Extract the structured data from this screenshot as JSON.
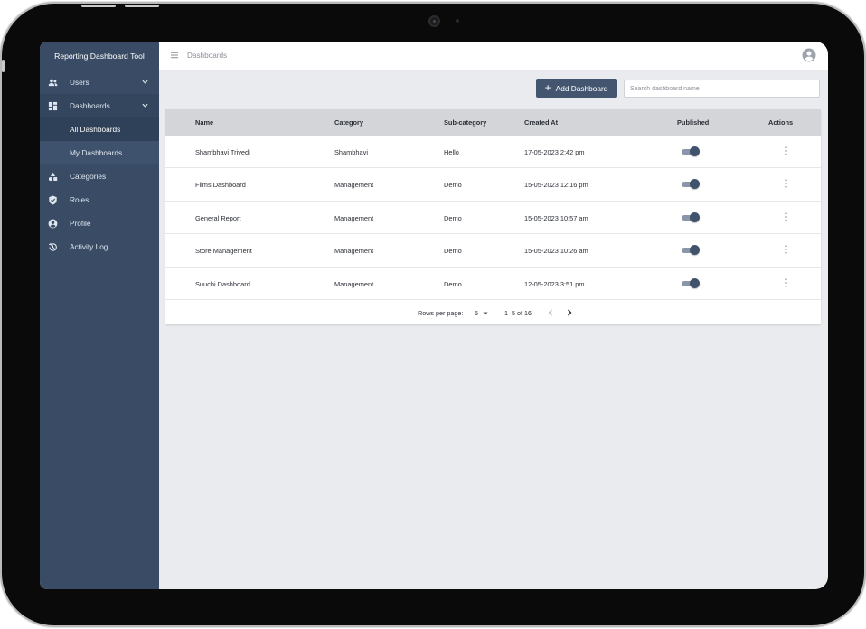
{
  "app": {
    "title": "Reporting Dashboard Tool"
  },
  "sidebar": {
    "items": [
      {
        "label": "Users",
        "icon": "users-icon",
        "expandable": true
      },
      {
        "label": "Dashboards",
        "icon": "dashboard-icon",
        "expandable": true,
        "open": true,
        "children": [
          {
            "label": "All Dashboards",
            "active": true
          },
          {
            "label": "My Dashboards"
          }
        ]
      },
      {
        "label": "Categories",
        "icon": "categories-icon"
      },
      {
        "label": "Roles",
        "icon": "shield-icon"
      },
      {
        "label": "Profile",
        "icon": "profile-icon"
      },
      {
        "label": "Activity Log",
        "icon": "history-icon"
      }
    ]
  },
  "header": {
    "breadcrumb": "Dashboards",
    "menu_icon": "menu-icon",
    "avatar_icon": "account-circle-icon"
  },
  "toolbar": {
    "add_label": "Add Dashboard",
    "search_placeholder": "Search dashboard name"
  },
  "table": {
    "columns": [
      "Name",
      "Category",
      "Sub-category",
      "Created At",
      "Published",
      "Actions"
    ],
    "rows": [
      {
        "name": "Shambhavi Trivedi",
        "category": "Shambhavi",
        "subcategory": "Hello",
        "created": "17-05-2023 2:42 pm",
        "published": true
      },
      {
        "name": "Films Dashboard",
        "category": "Management",
        "subcategory": "Demo",
        "created": "15-05-2023 12:16 pm",
        "published": true
      },
      {
        "name": "General Report",
        "category": "Management",
        "subcategory": "Demo",
        "created": "15-05-2023 10:57 am",
        "published": true
      },
      {
        "name": "Store Management",
        "category": "Management",
        "subcategory": "Demo",
        "created": "15-05-2023 10:26 am",
        "published": true
      },
      {
        "name": "Suuchi Dashboard",
        "category": "Management",
        "subcategory": "Demo",
        "created": "12-05-2023 3:51 pm",
        "published": true
      }
    ]
  },
  "pagination": {
    "rows_label": "Rows per page:",
    "rows_value": "5",
    "range": "1–5 of 16"
  },
  "colors": {
    "sidebar": "#3a4c65",
    "accent": "#44566f",
    "header_row": "#d3d5d9",
    "background": "#e9ebee"
  }
}
